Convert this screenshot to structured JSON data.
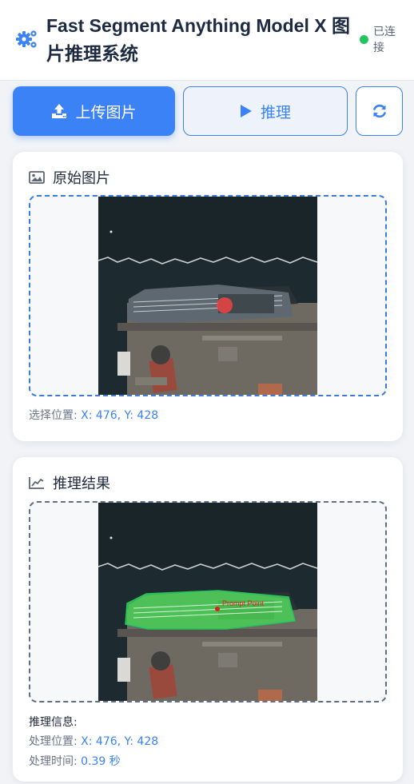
{
  "header": {
    "title": "Fast Segment Anything Model X 图片推理系统",
    "status": "已连接",
    "status_color": "#22c55e",
    "icon": "gears-icon"
  },
  "toolbar": {
    "upload_label": "上传图片",
    "infer_label": "推理",
    "upload_icon": "upload-icon",
    "infer_icon": "play-icon",
    "refresh_icon": "refresh-icon",
    "accent": "#3b82f6"
  },
  "original": {
    "title": "原始图片",
    "icon": "image-icon",
    "position_label": "选择位置:",
    "position_value": "X: 476, Y: 428"
  },
  "result": {
    "title": "推理结果",
    "icon": "chart-line-icon",
    "overlay_label": "Prompt Point",
    "mask_color": "#4ade50",
    "info_heading": "推理信息:",
    "position_label": "处理位置:",
    "position_value": "X: 476, Y: 428",
    "time_label": "处理时间:",
    "time_value": "0.39 秒"
  }
}
